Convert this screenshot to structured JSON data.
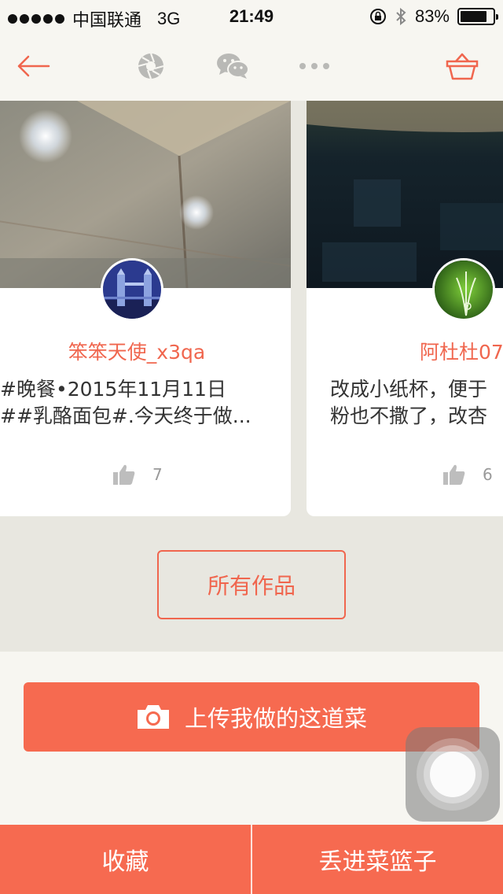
{
  "status_bar": {
    "carrier": "中国联通",
    "network": "3G",
    "time": "21:49",
    "battery": "83%",
    "battery_level": 0.83
  },
  "nav": {
    "back_icon": "arrow-left-icon",
    "share_moments_icon": "aperture-icon",
    "share_wechat_icon": "wechat-icon",
    "more_icon": "more-dots-icon",
    "basket_icon": "basket-icon",
    "accent_color": "#f0664e"
  },
  "works": [
    {
      "author": "笨笨天使_x3qa",
      "description_line1": "#晚餐•2015年11月11日",
      "description_line2": "##乳酪面包#.今天终于做...",
      "likes": "7"
    },
    {
      "author": "阿杜杜07",
      "description_line1": "改成小纸杯，便于",
      "description_line2": "粉也不撒了，改杏",
      "likes": "6"
    }
  ],
  "all_works_label": "所有作品",
  "upload_label": "上传我做的这道菜",
  "bottom_bar": {
    "favorite_label": "收藏",
    "add_basket_label": "丢进菜篮子"
  }
}
